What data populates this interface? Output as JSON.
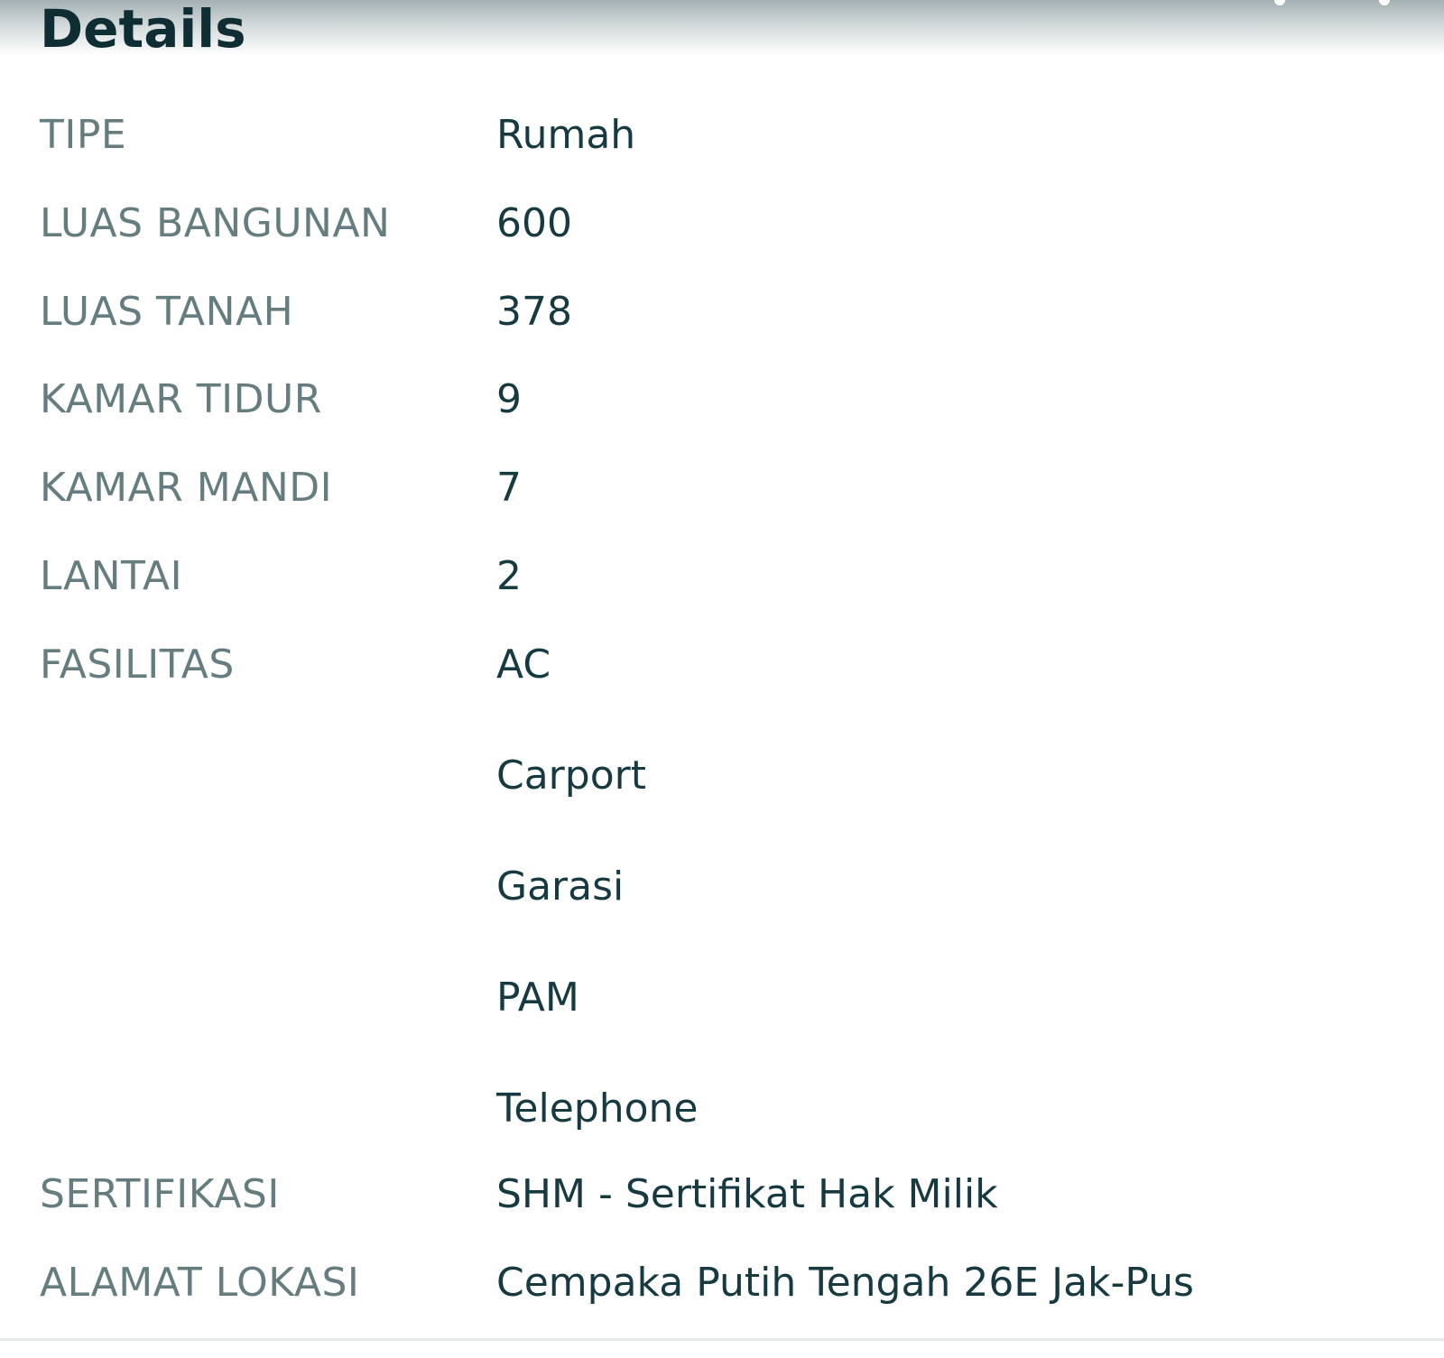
{
  "page": {
    "title": "Details"
  },
  "details": [
    {
      "label": "TIPE",
      "value": "Rumah"
    },
    {
      "label": "LUAS BANGUNAN",
      "value": "600"
    },
    {
      "label": "LUAS TANAH",
      "value": "378"
    },
    {
      "label": "KAMAR TIDUR",
      "value": "9"
    },
    {
      "label": "KAMAR MANDI",
      "value": "7"
    },
    {
      "label": "LANTAI",
      "value": "2"
    },
    {
      "label": "FASILITAS",
      "value": "AC"
    },
    {
      "label": "",
      "value": "Carport"
    },
    {
      "label": "",
      "value": "Garasi"
    },
    {
      "label": "",
      "value": "PAM"
    },
    {
      "label": "",
      "value": "Telephone"
    },
    {
      "label": "SERTIFIKASI",
      "value": "SHM - Sertifikat Hak Milik"
    },
    {
      "label": "ALAMAT LOKASI",
      "value": "Cempaka Putih Tengah 26E Jak-Pus"
    }
  ],
  "colors": {
    "title": "#0f2e33",
    "label": "#667d80",
    "value": "#163a40"
  }
}
